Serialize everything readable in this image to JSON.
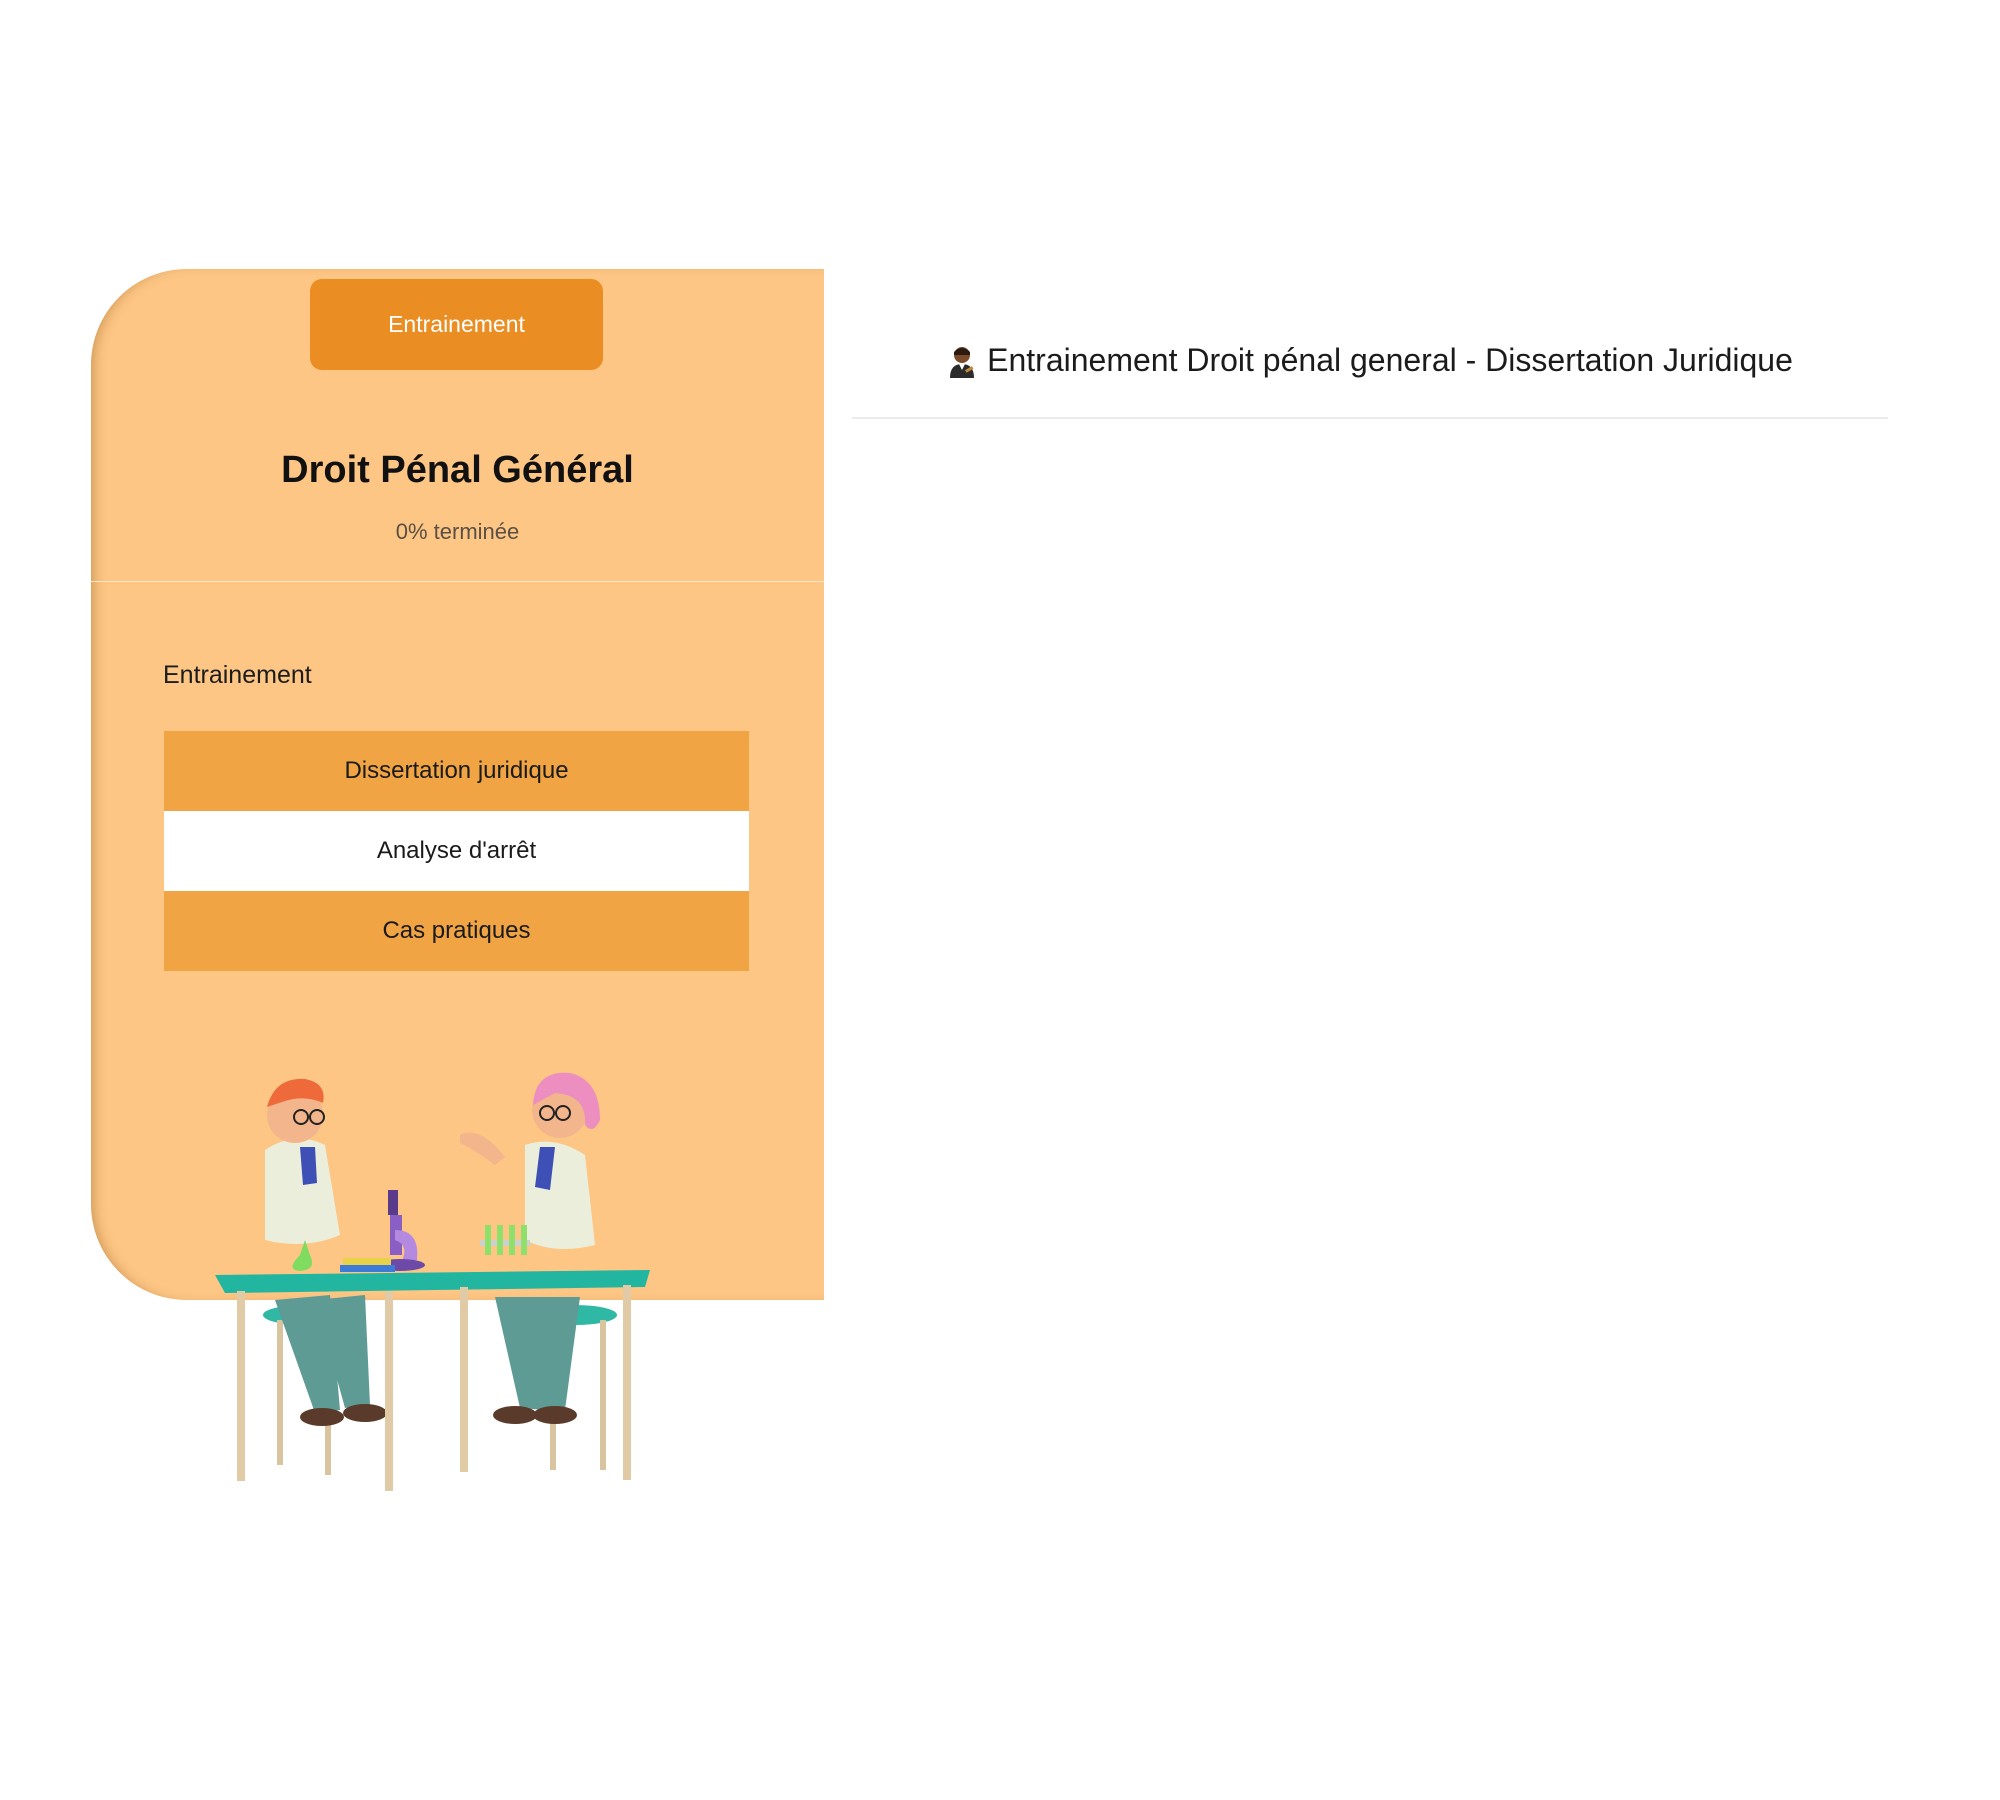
{
  "sidebar": {
    "top_button_label": "Entrainement",
    "course_title": "Droit Pénal Général",
    "progress_text": "0% terminée",
    "section_label": "Entrainement",
    "items": [
      {
        "label": "Dissertation juridique",
        "active": false
      },
      {
        "label": "Analyse d'arrêt",
        "active": true
      },
      {
        "label": "Cas pratiques",
        "active": false
      }
    ]
  },
  "content": {
    "title_icon": "judge-icon",
    "title": "Entrainement Droit pénal general - Dissertation Juridique"
  },
  "colors": {
    "panel": "#fdc684",
    "button": "#ea8d22",
    "nav_item": "#f0a444",
    "nav_item_active": "#ffffff"
  }
}
